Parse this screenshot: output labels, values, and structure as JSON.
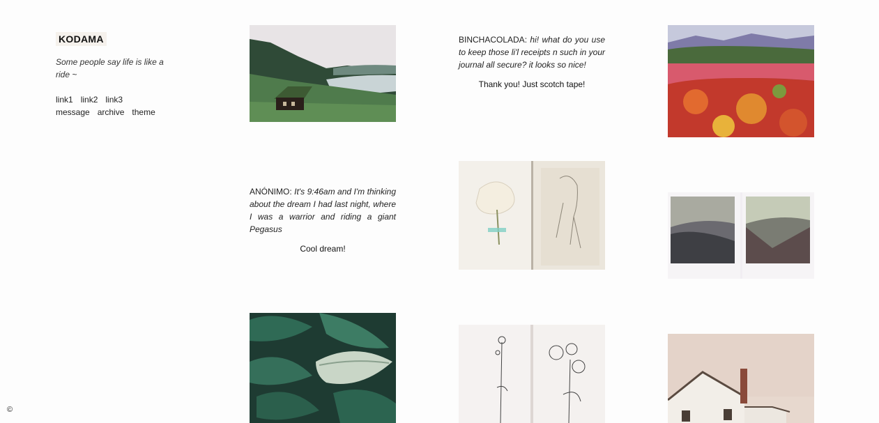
{
  "blog": {
    "title": "KODAMA",
    "description": "Some people say life is like a ride ~",
    "nav_row1": [
      "link1",
      "link2",
      "link3"
    ],
    "nav_row2": [
      "message",
      "archive",
      "theme"
    ],
    "copyright": "©"
  },
  "posts": {
    "ask1": {
      "asker": "BINCHACOLADA:",
      "question": "hi! what do you use to keep those li'l receipts n such in your journal all secure? it looks so nice!",
      "answer": "Thank you! Just scotch tape!"
    },
    "ask2": {
      "asker": "ANÓNIMO:",
      "question": "It's 9:46am and I'm thinking about the dream I had last night, where I was a warrior and riding a giant Pegasus",
      "answer": "Cool dream!"
    }
  },
  "photos": [
    {
      "subject": "cabin by a lake",
      "icon": "landscape-photo"
    },
    {
      "subject": "flower field painting",
      "icon": "painting-photo"
    },
    {
      "subject": "pressed flower and sketch journal",
      "icon": "journal-photo"
    },
    {
      "subject": "two polaroid landscapes",
      "icon": "polaroid-photo"
    },
    {
      "subject": "green leaves",
      "icon": "leaves-photo"
    },
    {
      "subject": "flower line drawings",
      "icon": "drawing-photo"
    },
    {
      "subject": "white house with chimney",
      "icon": "house-photo"
    }
  ]
}
